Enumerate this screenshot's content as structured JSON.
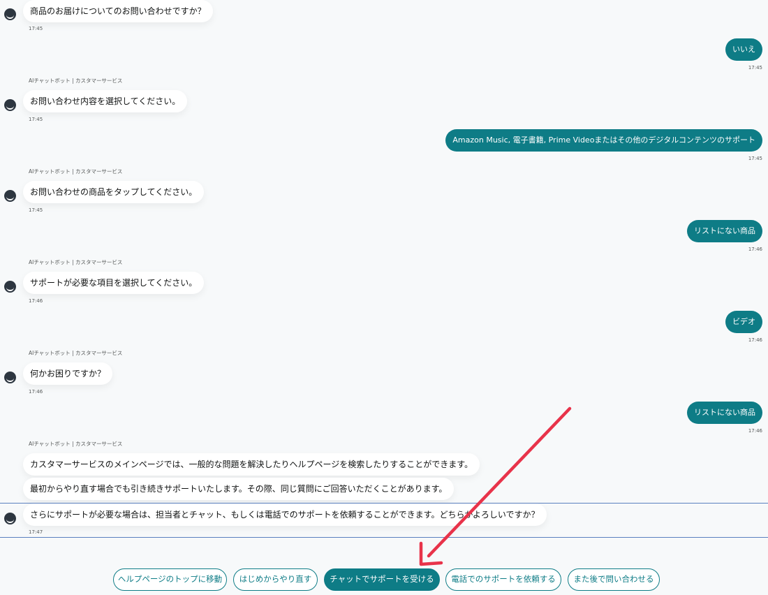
{
  "bot_name": "AIチャットボット | カスタマーサービス",
  "messages": {
    "m1": {
      "text": "商品のお届けについてのお問い合わせですか？",
      "time": "17:45"
    },
    "u1": {
      "text": "いいえ",
      "time": "17:45"
    },
    "m2": {
      "text": "お問い合わせ内容を選択してください。",
      "time": "17:45"
    },
    "u2": {
      "text": "Amazon Music, 電子書籍, Prime Videoまたはその他のデジタルコンテンツのサポート",
      "time": "17:45"
    },
    "m3": {
      "text": "お問い合わせの商品をタップしてください。",
      "time": "17:45"
    },
    "u3": {
      "text": "リストにない商品",
      "time": "17:46"
    },
    "m4": {
      "text": "サポートが必要な項目を選択してください。",
      "time": "17:46"
    },
    "u4": {
      "text": "ビデオ",
      "time": "17:46"
    },
    "m5": {
      "text": "何かお困りですか？",
      "time": "17:46"
    },
    "u5": {
      "text": "リストにない商品",
      "time": "17:46"
    },
    "m6a": {
      "text": "カスタマーサービスのメインページでは、一般的な問題を解決したりヘルプページを検索したりすることができます。"
    },
    "m6b": {
      "text": "最初からやり直す場合でも引き続きサポートいたします。その際、同じ質問にご回答いただくことがあります。"
    },
    "m6c": {
      "text": "さらにサポートが必要な場合は、担当者とチャット、もしくは電話でのサポートを依頼することができます。どちらがよろしいですか？",
      "time": "17:47"
    }
  },
  "options": {
    "help_top": "ヘルプページのトップに移動",
    "restart": "はじめからやり直す",
    "chat": "チャットでサポートを受ける",
    "phone": "電話でのサポートを依頼する",
    "later": "また後で問い合わせる"
  },
  "colors": {
    "accent": "#0e7c86",
    "annotation_arrow": "#e8334a"
  },
  "icons": {
    "bot_avatar": "smile-avatar-icon"
  }
}
